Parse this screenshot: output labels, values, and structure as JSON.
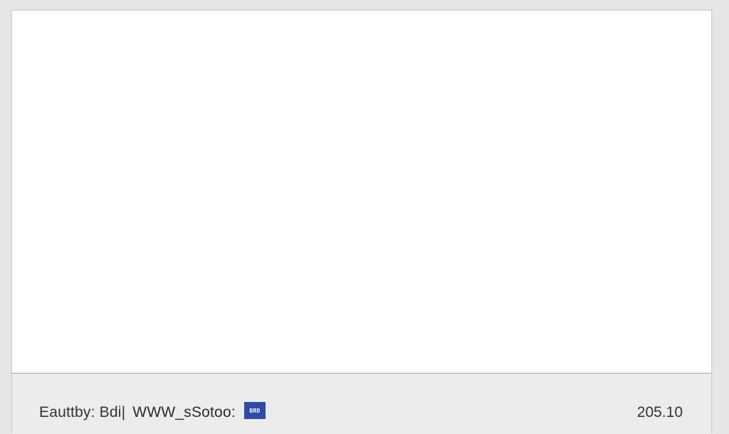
{
  "status_bar": {
    "caption": "Eauttby: Bdi|",
    "url": "WWW_sSotoo:",
    "badge_text": "BRD",
    "right_text": "205.10"
  },
  "colors": {
    "page_background": "#e6e6e6",
    "content_background": "#ffffff",
    "status_bar_background": "#ececec",
    "status_bar_top_border": "#9aa0d0",
    "badge_color": "#2f4aa8"
  },
  "icons": {
    "badge": "brand-logo-icon"
  }
}
